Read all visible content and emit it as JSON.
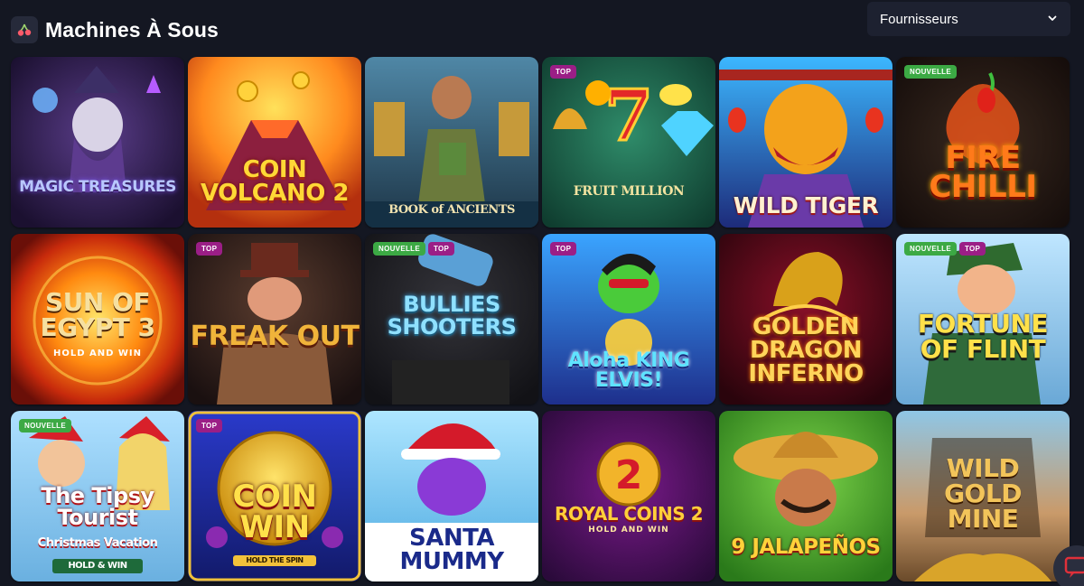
{
  "header": {
    "title": "Machines À Sous",
    "section_icon": "cherries-icon",
    "provider_select": {
      "value": "Fournisseurs",
      "icon": "chevron-down-icon"
    }
  },
  "badges": {
    "new": "NOUVELLE",
    "top": "TOP"
  },
  "games": [
    {
      "title": "MAGIC TREASURES",
      "badges": []
    },
    {
      "title": "COIN VOLCANO 2",
      "badges": []
    },
    {
      "title": "BOOK of ANCIENTS",
      "badges": []
    },
    {
      "title": "FRUIT MILLION",
      "badges": [
        "top"
      ]
    },
    {
      "title": "WILD TIGER",
      "badges": []
    },
    {
      "title": "FIRE CHILLI",
      "badges": [
        "new"
      ]
    },
    {
      "title": "SUN OF EGYPT 3",
      "subtitle": "HOLD AND WIN",
      "badges": []
    },
    {
      "title": "FREAK OUT",
      "badges": [
        "top"
      ]
    },
    {
      "title": "BULLIES SHOOTERS",
      "badges": [
        "new",
        "top"
      ]
    },
    {
      "title": "Aloha KING ELVIS!",
      "badges": [
        "top"
      ]
    },
    {
      "title": "GOLDEN DRAGON INFERNO",
      "badges": []
    },
    {
      "title": "FORTUNE OF FLINT",
      "badges": [
        "new",
        "top"
      ]
    },
    {
      "title": "The Tipsy Tourist",
      "subtitle": "Christmas Vacation",
      "extra": "HOLD & WIN",
      "badges": [
        "new"
      ]
    },
    {
      "title": "COIN WIN",
      "subtitle": "HOLD THE SPIN",
      "badges": [
        "top"
      ]
    },
    {
      "title": "SANTA MUMMY",
      "badges": []
    },
    {
      "title": "ROYAL COINS 2",
      "subtitle": "HOLD AND WIN",
      "badges": []
    },
    {
      "title": "9 JALAPEÑOS",
      "badges": []
    },
    {
      "title": "WILD GOLD MINE",
      "badges": []
    }
  ],
  "chat": {
    "icon": "chat-icon"
  },
  "colors": {
    "background": "#141722",
    "badge_new": "#3ca944",
    "badge_top": "#9b1e86"
  }
}
